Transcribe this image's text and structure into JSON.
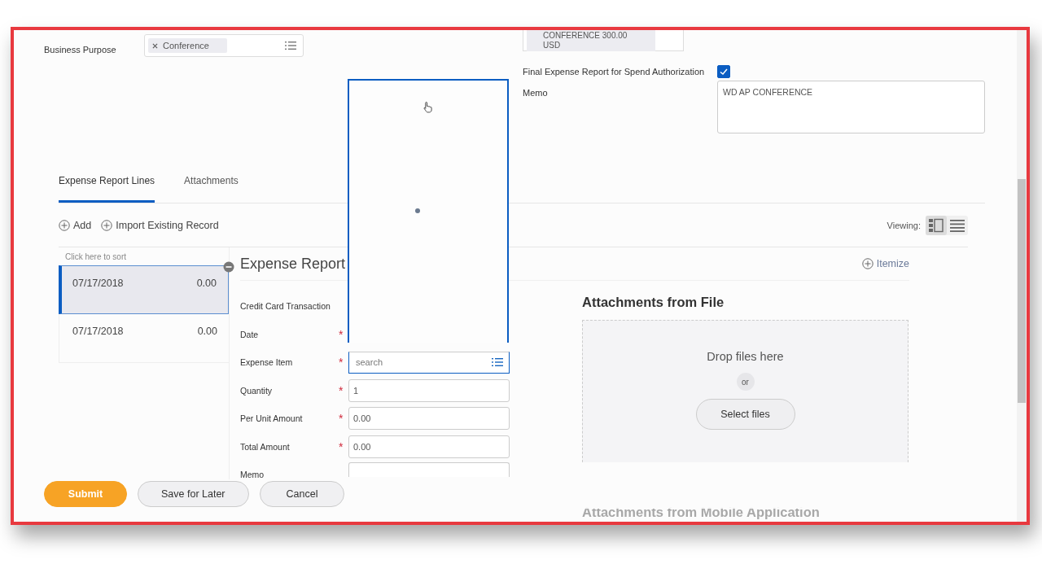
{
  "business_purpose": {
    "label": "Business Purpose",
    "tags": [
      "Conference"
    ]
  },
  "spend_authorization": {
    "lines": [
      "CONFERENCE 300.00",
      "USD"
    ]
  },
  "final_report": {
    "label": "Final Expense Report for Spend Authorization",
    "checked": true
  },
  "memo": {
    "label": "Memo",
    "value": "WD AP CONFERENCE"
  },
  "tabs": [
    {
      "label": "Expense Report Lines",
      "selected": true
    },
    {
      "label": "Attachments",
      "selected": false
    }
  ],
  "actions": [
    "Add",
    "Import Existing Record"
  ],
  "viewing": {
    "label": "Viewing:",
    "modes": [
      {
        "kind": "split",
        "selected": true
      },
      {
        "kind": "list",
        "selected": false
      }
    ]
  },
  "lines": {
    "sort_hint": "Click here to sort",
    "rows": [
      {
        "date": "07/17/2018",
        "amount": "0.00",
        "selected": true
      },
      {
        "date": "07/17/2018",
        "amount": "0.00",
        "selected": false
      }
    ]
  },
  "detail": {
    "title": "Expense Report",
    "itemize": "Itemize",
    "required_mark": "*",
    "fields": [
      {
        "label": "Credit Card Transaction",
        "required": false,
        "kind": "none"
      },
      {
        "label": "Date",
        "required": true,
        "kind": "covered"
      },
      {
        "label": "Expense Item",
        "required": true,
        "kind": "search",
        "placeholder": "search"
      },
      {
        "label": "Quantity",
        "required": true,
        "kind": "text",
        "value": "1"
      },
      {
        "label": "Per Unit Amount",
        "required": true,
        "kind": "text",
        "value": "0.00"
      },
      {
        "label": "Total Amount",
        "required": true,
        "kind": "text",
        "value": "0.00"
      },
      {
        "label": "Memo",
        "required": false,
        "kind": "text"
      }
    ]
  },
  "attachments": {
    "title": "Attachments from File",
    "drop": "Drop files here",
    "or": "or",
    "select": "Select files",
    "mobile_title": "Attachments from Mobile Application"
  },
  "buttons": [
    {
      "label": "Submit",
      "kind": "primary"
    },
    {
      "label": "Save for Later",
      "kind": "secondary"
    },
    {
      "label": "Cancel",
      "kind": "secondary"
    }
  ]
}
